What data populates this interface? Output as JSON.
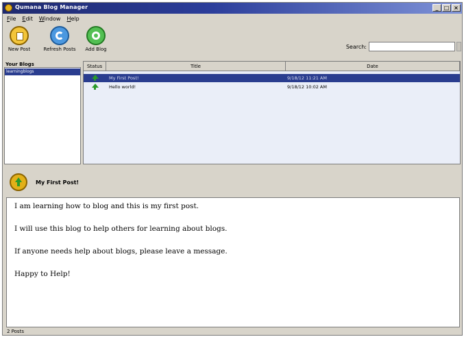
{
  "window": {
    "title": "Qumana Blog Manager",
    "buttons": [
      "_",
      "□",
      "×"
    ]
  },
  "menu": {
    "items": [
      "File",
      "Edit",
      "Window",
      "Help"
    ]
  },
  "toolbar": {
    "buttons": [
      {
        "label": "New Post",
        "icon": "new-post-icon",
        "color": "#e2b019"
      },
      {
        "label": "Refresh Posts",
        "icon": "refresh-icon",
        "color": "#2f7fd1"
      },
      {
        "label": "Add Blog",
        "icon": "add-blog-icon",
        "color": "#37a837"
      }
    ],
    "search": {
      "label": "Search:",
      "value": ""
    }
  },
  "blogs": {
    "heading": "Your Blogs",
    "items": [
      "learningblogs"
    ]
  },
  "posts": {
    "columns": [
      "Status",
      "Title",
      "Date"
    ],
    "rows": [
      {
        "status": "published",
        "title": "My First Post!",
        "date": "9/18/12 11:21 AM",
        "selected": true
      },
      {
        "status": "published",
        "title": "Hello world!",
        "date": "9/18/12 10:02 AM",
        "selected": false
      }
    ]
  },
  "preview": {
    "title": "My First Post!",
    "paragraphs": [
      "I am learning how to blog and this is my first post.",
      "I will use this blog to help others for learning about blogs.",
      "If anyone needs help about blogs, please leave a message.",
      "Happy to Help!"
    ]
  },
  "status": {
    "text": "2 Posts"
  },
  "colors": {
    "titlebar": "#1f2a6e",
    "selection": "#2a3d8f",
    "accent_green": "#2a9a2a"
  }
}
